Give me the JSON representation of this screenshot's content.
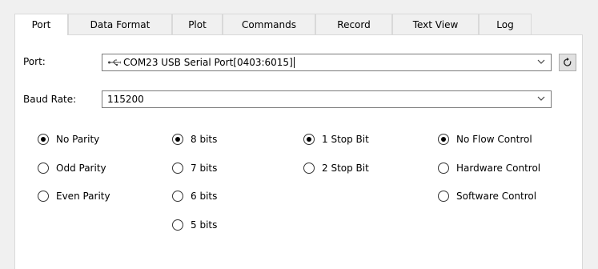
{
  "tabs": [
    "Port",
    "Data Format",
    "Plot",
    "Commands",
    "Record",
    "Text View",
    "Log"
  ],
  "port": {
    "label": "Port:",
    "value": "COM23 USB Serial Port[0403:6015]",
    "icon": "usb-icon",
    "refresh_icon": "refresh-icon"
  },
  "baud": {
    "label": "Baud Rate:",
    "value": "115200"
  },
  "parity": [
    "No Parity",
    "Odd Parity",
    "Even Parity"
  ],
  "data_bits": [
    "8 bits",
    "7 bits",
    "6 bits",
    "5 bits"
  ],
  "stop_bits": [
    "1 Stop Bit",
    "2 Stop Bit"
  ],
  "flow_control": [
    "No Flow Control",
    "Hardware Control",
    "Software Control"
  ],
  "selected": {
    "parity": "No Parity",
    "data_bits": "8 bits",
    "stop_bits": "1 Stop Bit",
    "flow_control": "No Flow Control"
  }
}
